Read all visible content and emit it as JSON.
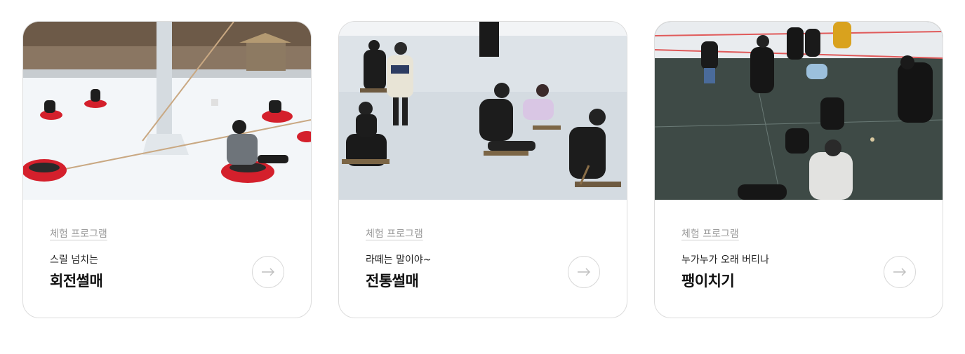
{
  "cards": [
    {
      "category": "체험 프로그램",
      "subtitle": "스릴 넘치는",
      "title": "회전썰매",
      "image_icon": "photo-snow-tube-rotating-sled",
      "button_icon": "arrow-right-icon"
    },
    {
      "category": "체험 프로그램",
      "subtitle": "라떼는 말이야~",
      "title": "전통썰매",
      "image_icon": "photo-traditional-ice-sled",
      "button_icon": "arrow-right-icon"
    },
    {
      "category": "체험 프로그램",
      "subtitle": "누가누가 오래 버티나",
      "title": "팽이치기",
      "image_icon": "photo-top-spinning-on-ice",
      "button_icon": "arrow-right-icon"
    }
  ],
  "colors": {
    "border": "#dcdcdc",
    "category_text": "#9a9a9a",
    "title_text": "#111111"
  }
}
